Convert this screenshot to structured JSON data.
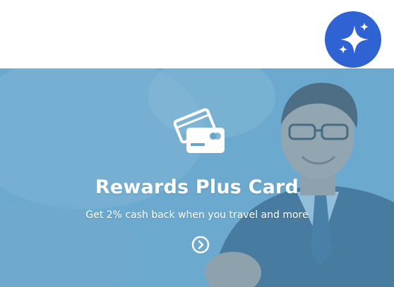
{
  "assistant_button": {
    "icon": "sparkle-icon",
    "color": "#2f63d4"
  },
  "promo": {
    "title": "Rewards Plus Card",
    "subtitle": "Get 2% cash back when you travel and more",
    "icon": "credit-card-icon",
    "action_icon": "chevron-right-circle-icon",
    "overlay_color": "#5ca0ca"
  }
}
